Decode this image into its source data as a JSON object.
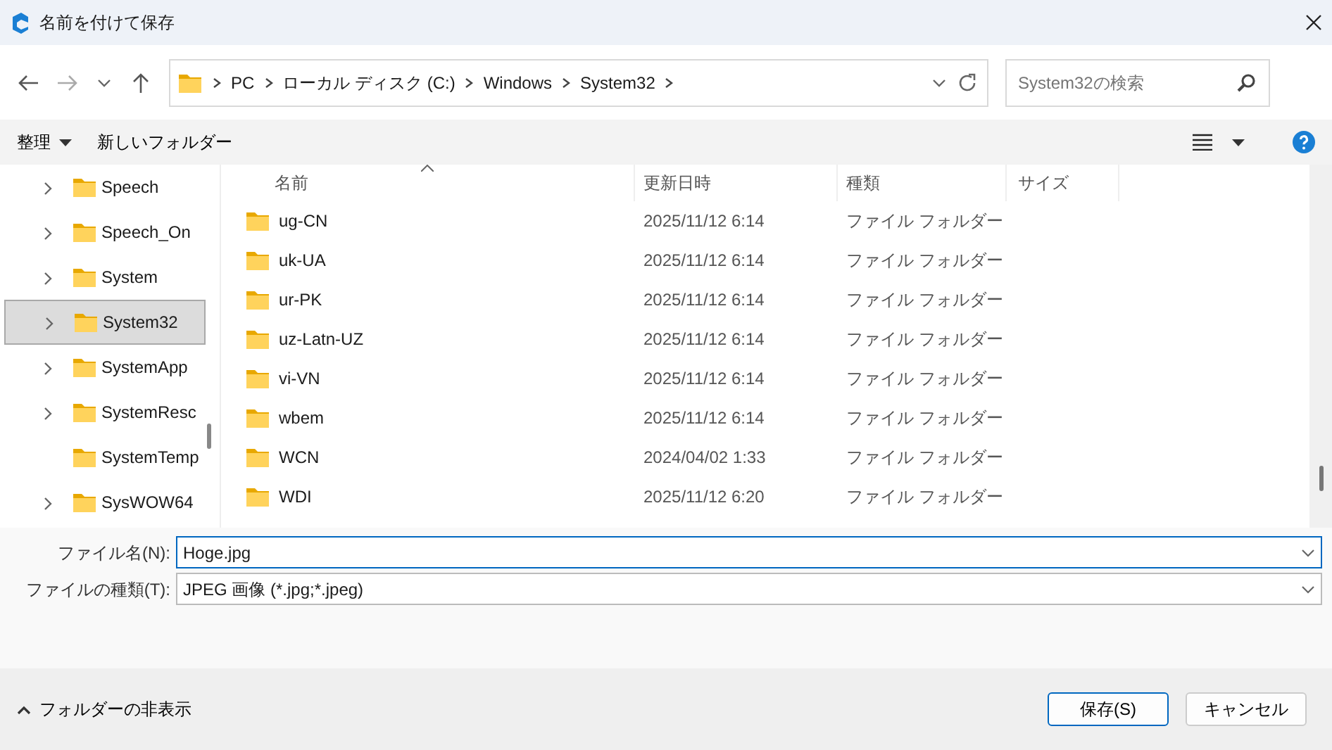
{
  "window": {
    "title": "名前を付けて保存"
  },
  "address": {
    "crumbs": [
      "PC",
      "ローカル ディスク (C:)",
      "Windows",
      "System32"
    ]
  },
  "search": {
    "placeholder": "System32の検索"
  },
  "toolbar": {
    "organize": "整理",
    "new_folder": "新しいフォルダー"
  },
  "sidebar": {
    "items": [
      {
        "label": "Speech",
        "expandable": true,
        "selected": false
      },
      {
        "label": "Speech_On",
        "expandable": true,
        "selected": false
      },
      {
        "label": "System",
        "expandable": true,
        "selected": false
      },
      {
        "label": "System32",
        "expandable": true,
        "selected": true
      },
      {
        "label": "SystemApp",
        "expandable": true,
        "selected": false
      },
      {
        "label": "SystemResc",
        "expandable": true,
        "selected": false
      },
      {
        "label": "SystemTemp",
        "expandable": false,
        "selected": false
      },
      {
        "label": "SysWOW64",
        "expandable": true,
        "selected": false
      }
    ]
  },
  "table": {
    "columns": [
      "名前",
      "更新日時",
      "種類",
      "サイズ"
    ],
    "rows": [
      [
        "ug-CN",
        "2025/11/12 6:14",
        "ファイル フォルダー"
      ],
      [
        "uk-UA",
        "2025/11/12 6:14",
        "ファイル フォルダー"
      ],
      [
        "ur-PK",
        "2025/11/12 6:14",
        "ファイル フォルダー"
      ],
      [
        "uz-Latn-UZ",
        "2025/11/12 6:14",
        "ファイル フォルダー"
      ],
      [
        "vi-VN",
        "2025/11/12 6:14",
        "ファイル フォルダー"
      ],
      [
        "wbem",
        "2025/11/12 6:14",
        "ファイル フォルダー"
      ],
      [
        "WCN",
        "2024/04/02 1:33",
        "ファイル フォルダー"
      ],
      [
        "WDI",
        "2025/11/12 6:20",
        "ファイル フォルダー"
      ]
    ]
  },
  "form": {
    "file_name_label": "ファイル名(N):",
    "file_name": "Hoge.jpg",
    "file_type_label": "ファイルの種類(T):",
    "file_type": "JPEG 画像 (*.jpg;*.jpeg)"
  },
  "footer": {
    "hide_folders": "フォルダーの非表示",
    "save": "保存(S)",
    "cancel": "キャンセル"
  }
}
